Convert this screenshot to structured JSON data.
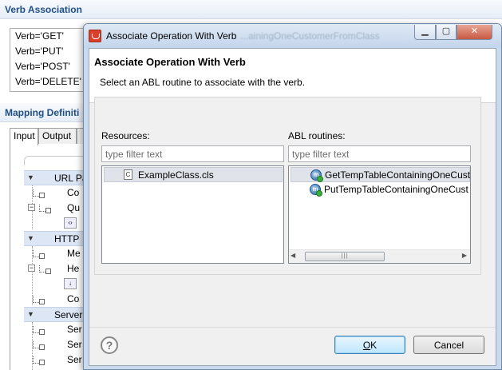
{
  "background": {
    "verb_section_title": "Verb Association",
    "verbs": [
      "Verb='GET'",
      "Verb='PUT'",
      "Verb='POST'",
      "Verb='DELETE'"
    ],
    "mapping_section_title": "Mapping Definiti",
    "tabs": {
      "input": "Input",
      "output": "Output"
    },
    "tree": {
      "url_params": "URL Pa",
      "co1": "Co",
      "qu": "Qu",
      "http": "HTTP",
      "me": "Me",
      "he": "He",
      "co2": "Co",
      "server": "Server",
      "se1": "Ser",
      "se2": "Ser",
      "se3": "Ser"
    }
  },
  "dialog": {
    "window_title": "Associate Operation With Verb",
    "title_ghost_text": "...ainingOneCustomerFromClass",
    "heading": "Associate Operation With Verb",
    "description": "Select an ABL routine to associate with the verb.",
    "resources": {
      "label": "Resources:",
      "filter_placeholder": "type filter text",
      "items": [
        "ExampleClass.cls"
      ]
    },
    "abl_routines": {
      "label": "ABL routines:",
      "filter_placeholder": "type filter text",
      "items": [
        "GetTempTableContainingOneCust",
        "PutTempTableContainingOneCust"
      ]
    },
    "buttons": {
      "ok_rest": "K",
      "ok_mnemonic": "O",
      "cancel": "Cancel"
    },
    "icons": {
      "title": "app-logo-icon",
      "class_file": "class-file-icon",
      "method": "method-icon",
      "help": "help-icon"
    }
  }
}
